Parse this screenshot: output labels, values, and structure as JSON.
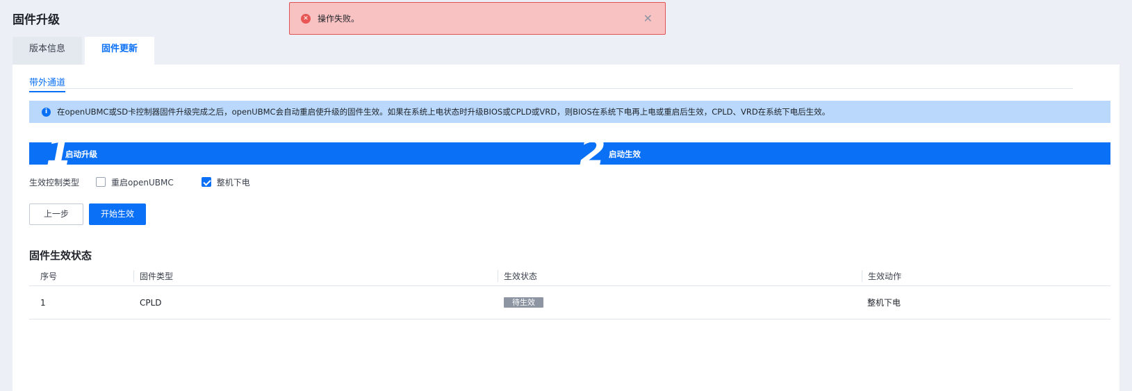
{
  "page": {
    "title": "固件升级"
  },
  "tabs": [
    {
      "label": "版本信息",
      "active": false
    },
    {
      "label": "固件更新",
      "active": true
    }
  ],
  "subtab": {
    "label": "带外通道"
  },
  "info": {
    "icon": "info-icon",
    "text": "在openUBMC或SD卡控制器固件升级完成之后，openUBMC会自动重启使升级的固件生效。如果在系统上电状态时升级BIOS或CPLD或VRD，则BIOS在系统下电再上电或重启后生效，CPLD、VRD在系统下电后生效。"
  },
  "steps": [
    {
      "num": "1",
      "label": "启动升级"
    },
    {
      "num": "2",
      "label": "启动生效"
    }
  ],
  "control": {
    "label": "生效控制类型",
    "options": [
      {
        "label": "重启openUBMC",
        "checked": false
      },
      {
        "label": "整机下电",
        "checked": true
      }
    ]
  },
  "buttons": {
    "prev": "上一步",
    "start": "开始生效"
  },
  "status_section": {
    "title": "固件生效状态",
    "columns": [
      "序号",
      "固件类型",
      "生效状态",
      "生效动作"
    ],
    "rows": [
      {
        "index": "1",
        "type": "CPLD",
        "status": "待生效",
        "action": "整机下电"
      }
    ]
  },
  "toast": {
    "icon": "error-icon",
    "message": "操作失败。",
    "close_icon": "close-icon"
  },
  "colors": {
    "accent": "#0a70f5",
    "error": "#e05252",
    "info_bg": "#b9d8fb"
  }
}
